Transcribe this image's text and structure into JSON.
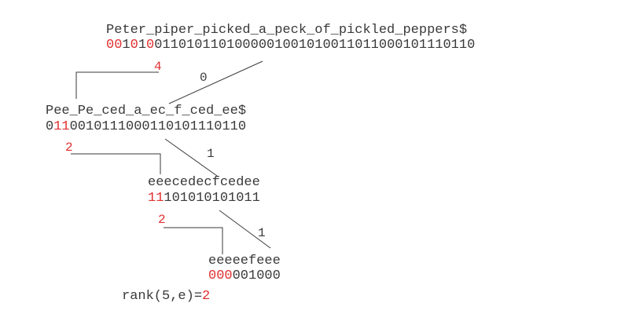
{
  "colors": {
    "text": "#3a3a3a",
    "highlight": "#e03030",
    "line": "#3a3a3a"
  },
  "levels": [
    {
      "string": "Peter_piper_picked_a_peck_of_pickled_peppers$",
      "bits_highlight": [
        "0",
        "0",
        "1",
        "0",
        "1",
        "0"
      ],
      "bits_rest": "0110101101000001001010011011000101110110"
    },
    {
      "string": "Pee_Pe_ced_a_ec_f_ced_ee$",
      "bits_plain_prefix": "0",
      "bits_highlight": "11",
      "bits_rest": "0010111000110101110110"
    },
    {
      "string": "eeecedecfcedee",
      "bits_highlight": "11",
      "bits_rest": "101010101011"
    },
    {
      "string": "eeeeefeee",
      "bits_highlight": "000",
      "bits_rest": "001000"
    }
  ],
  "edge_labels": {
    "level0_left_rank": "4",
    "level0_right_bit": "0",
    "level1_left_rank": "2",
    "level1_right_bit": "1",
    "level2_left_rank": "2",
    "level2_right_bit": "1"
  },
  "query": {
    "expr": "rank(5,e)=",
    "result": "2"
  }
}
